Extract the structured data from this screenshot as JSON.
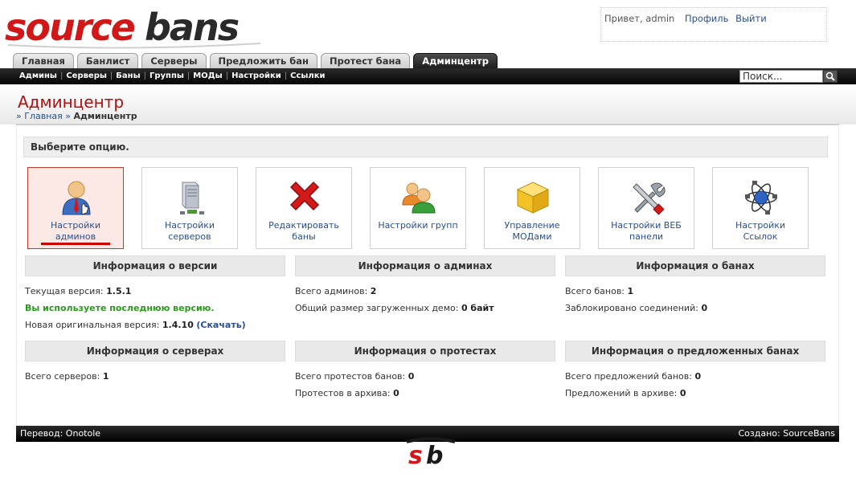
{
  "brand": {
    "logo_text": "sourcebans",
    "colors": {
      "accent_red": "#cc0000",
      "title_red": "#b01010",
      "link_blue": "#2b4e8c",
      "success_green": "#2b9a1e",
      "nav_dark": "#111111"
    }
  },
  "user": {
    "greeting": "Привет, admin",
    "profile_link": "Профиль",
    "logout_link": "Выйти"
  },
  "tabs": [
    {
      "label": "Главная",
      "active": false
    },
    {
      "label": "Банлист",
      "active": false
    },
    {
      "label": "Серверы",
      "active": false
    },
    {
      "label": "Предложить бан",
      "active": false
    },
    {
      "label": "Протест бана",
      "active": false
    },
    {
      "label": "Админцентр",
      "active": true
    }
  ],
  "subnav": [
    "Админы",
    "Серверы",
    "Баны",
    "Группы",
    "МОДы",
    "Настройки",
    "Ссылки"
  ],
  "search": {
    "value": "Поиск..."
  },
  "page": {
    "title": "Админцентр",
    "breadcrumb": {
      "home": "Главная",
      "current": "Админцентр"
    },
    "choose_label": "Выберите опцию."
  },
  "options": [
    {
      "line1": "Настройки",
      "line2": "админов",
      "icon": "admin-user-icon",
      "active": true
    },
    {
      "line1": "Настройки",
      "line2": "серверов",
      "icon": "server-icon",
      "active": false
    },
    {
      "line1": "Редактировать",
      "line2": "баны",
      "icon": "red-x-icon",
      "active": false
    },
    {
      "line1": "Настройки групп",
      "line2": "",
      "icon": "group-icon",
      "active": false
    },
    {
      "line1": "Управление",
      "line2": "МОДами",
      "icon": "box-icon",
      "active": false
    },
    {
      "line1": "Настройки ВЕБ",
      "line2": "панели",
      "icon": "tools-icon",
      "active": false
    },
    {
      "line1": "Настройки",
      "line2": "Ссылок",
      "icon": "network-icon",
      "active": false
    }
  ],
  "panels": {
    "version": {
      "title": "Информация о версии",
      "current_label": "Текущая версия:",
      "current_value": "1.5.1",
      "status": "Вы используете последнюю версию.",
      "new_label": "Новая оригинальная версия:",
      "new_value": "1.4.10",
      "download": "(Скачать)"
    },
    "admins": {
      "title": "Информация о админах",
      "total_label": "Всего админов:",
      "total_value": "2",
      "demo_label": "Общий размер загруженных демо:",
      "demo_value": "0 байт"
    },
    "bans": {
      "title": "Информация о банах",
      "total_label": "Всего банов:",
      "total_value": "1",
      "blocked_label": "Заблокировано соединений:",
      "blocked_value": "0"
    },
    "servers": {
      "title": "Информация о серверах",
      "total_label": "Всего серверов:",
      "total_value": "1"
    },
    "protests": {
      "title": "Информация о протестах",
      "total_label": "Всего протестов банов:",
      "total_value": "0",
      "archive_label": "Протестов в архива:",
      "archive_value": "0"
    },
    "submissions": {
      "title": "Информация о предложенных банах",
      "total_label": "Всего предложений банов:",
      "total_value": "0",
      "archive_label": "Предложений в архиве:",
      "archive_value": "0"
    }
  },
  "footer": {
    "left": "Перевод: Onotole",
    "right": "Создано: SourceBans",
    "logo_text": "sb"
  }
}
